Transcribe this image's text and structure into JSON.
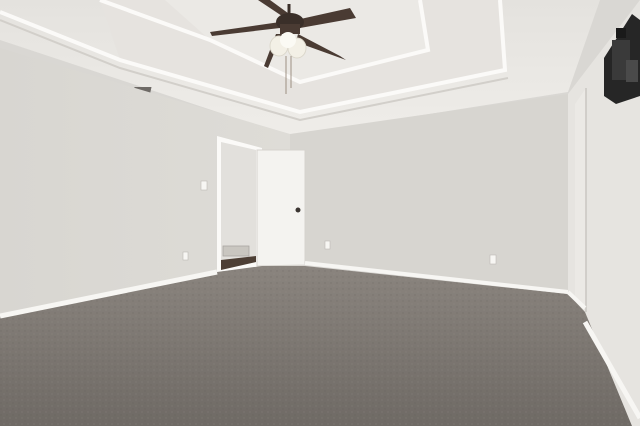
{
  "scene": {
    "kind": "empty-bedroom-interior",
    "features": [
      "tray-ceiling",
      "ceiling-fan",
      "open-white-door",
      "carpet-floor",
      "wall-mount-bracket",
      "air-vent",
      "light-switch",
      "power-outlets",
      "baseboards"
    ],
    "colors": {
      "ceiling": "#eceae6",
      "ceiling-shadow": "#dedbd6",
      "tray-trim": "#fbfaf8",
      "wall-left": "#dcdad5",
      "wall-back": "#d7d5d0",
      "wall-right": "#e6e4e0",
      "baseboard": "#f7f6f3",
      "carpet": "#6f6a65",
      "carpet-light": "#8a847e",
      "door": "#f4f3f0",
      "fan-blade": "#4a3b33",
      "fan-light": "#f3f0e6",
      "bracket": "#262626"
    }
  }
}
